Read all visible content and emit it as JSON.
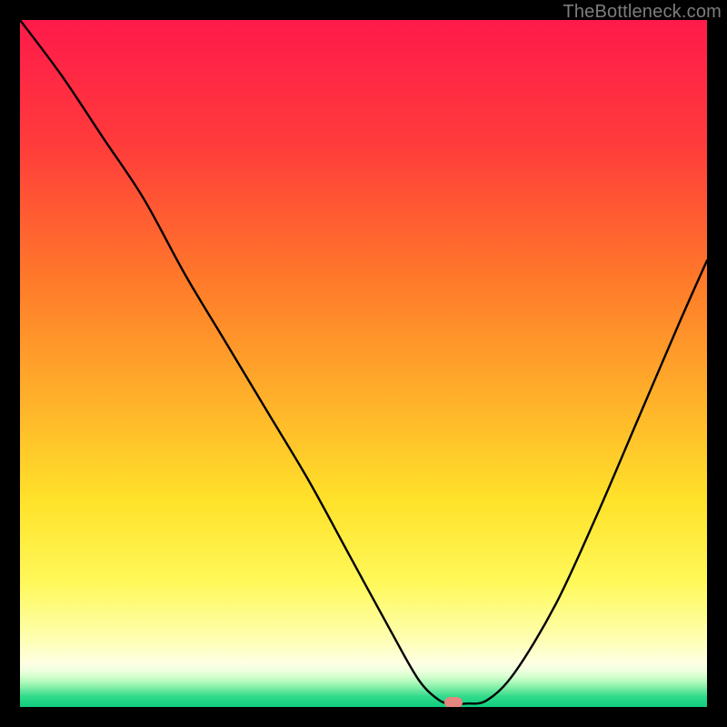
{
  "watermark": "TheBottleneck.com",
  "marker": {
    "color": "#e4877f",
    "x_pct": 63.1,
    "y_pct": 99.35
  },
  "chart_data": {
    "type": "line",
    "title": "",
    "xlabel": "",
    "ylabel": "",
    "x_range_pct": [
      0,
      100
    ],
    "y_range_pct": [
      0,
      100
    ],
    "series": [
      {
        "name": "bottleneck-curve",
        "x_pct": [
          0,
          6,
          12,
          18,
          24,
          30,
          36,
          42,
          48,
          54,
          58,
          61,
          63,
          65,
          68,
          72,
          78,
          84,
          90,
          96,
          100
        ],
        "y_pct": [
          100,
          92,
          83,
          74,
          63,
          53,
          43,
          33,
          22,
          11,
          4,
          1,
          0.5,
          0.5,
          1,
          5,
          15,
          28,
          42,
          56,
          65
        ]
      }
    ],
    "flat_zone_x_pct": [
      58.5,
      67
    ],
    "minimum_marker_x_pct": 63.1,
    "gradient_stops": [
      {
        "pct": 0.0,
        "color": "#ff1a4b"
      },
      {
        "pct": 18.0,
        "color": "#ff3b3b"
      },
      {
        "pct": 38.0,
        "color": "#ff7a2a"
      },
      {
        "pct": 55.0,
        "color": "#ffb02a"
      },
      {
        "pct": 70.0,
        "color": "#ffe22a"
      },
      {
        "pct": 82.0,
        "color": "#fff95a"
      },
      {
        "pct": 90.0,
        "color": "#feffb0"
      },
      {
        "pct": 93.5,
        "color": "#ffffe2"
      },
      {
        "pct": 94.5,
        "color": "#f2ffe0"
      },
      {
        "pct": 95.5,
        "color": "#d8ffd0"
      },
      {
        "pct": 96.5,
        "color": "#a8f7b8"
      },
      {
        "pct": 97.5,
        "color": "#6ee9a0"
      },
      {
        "pct": 98.5,
        "color": "#2fdb8b"
      },
      {
        "pct": 100.0,
        "color": "#0fce7d"
      }
    ]
  }
}
